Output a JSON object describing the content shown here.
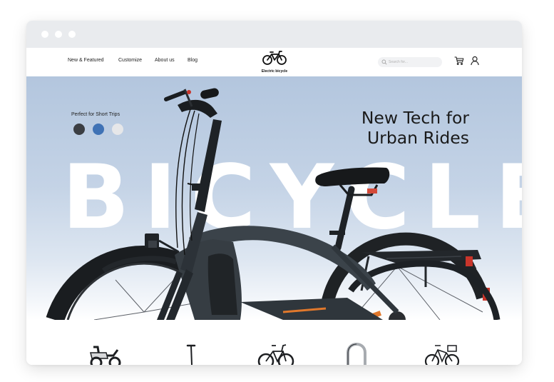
{
  "window": {
    "controls": [
      "window-dot-1",
      "window-dot-2",
      "window-dot-3"
    ]
  },
  "nav": {
    "links": [
      "New & Featured",
      "Customize",
      "About us",
      "Blog"
    ],
    "logo_text": "Electric bicycle",
    "search_placeholder": "Search for...",
    "cart_icon": "cart-icon",
    "user_icon": "user-icon"
  },
  "hero": {
    "tagline": "Perfect for Short Trips",
    "headline_line1": "New Tech for",
    "headline_line2": "Urban Rides",
    "background_word": "BICYCLE",
    "color_options": [
      "#3b3e43",
      "#3f72b5",
      "#e6e7e9"
    ],
    "selected_color": "#3f72b5"
  },
  "products": [
    "scooter",
    "kick-scooter",
    "mountain-bike",
    "bike-lock",
    "city-bike-with-basket"
  ],
  "colors": {
    "titlebar": "#e9ebee",
    "hero_top": "#b3c6de",
    "hero_bottom": "#ffffff",
    "frame": "#2f363c"
  }
}
